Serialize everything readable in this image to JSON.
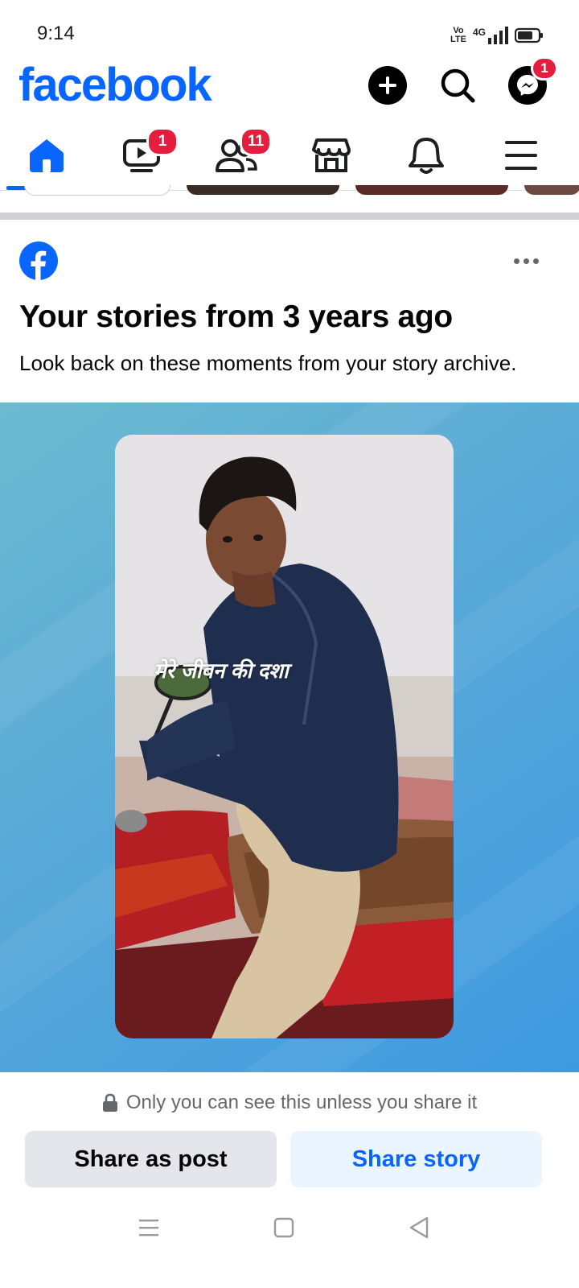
{
  "status_bar": {
    "time": "9:14",
    "volte_top": "Vo",
    "volte_bottom": "LTE",
    "network": "4G",
    "icons": [
      "volte-icon",
      "signal-icon",
      "battery-icon"
    ]
  },
  "header": {
    "logo": "facebook",
    "create_icon": "plus-icon",
    "search_icon": "search-icon",
    "messenger_icon": "messenger-icon",
    "messenger_badge": "1"
  },
  "tabs": [
    {
      "name": "home",
      "icon": "home-icon",
      "active": true,
      "badge": ""
    },
    {
      "name": "video",
      "icon": "video-icon",
      "active": false,
      "badge": "1"
    },
    {
      "name": "friends",
      "icon": "friends-icon",
      "active": false,
      "badge": "11"
    },
    {
      "name": "marketplace",
      "icon": "marketplace-icon",
      "active": false,
      "badge": ""
    },
    {
      "name": "notifications",
      "icon": "bell-icon",
      "active": false,
      "badge": ""
    },
    {
      "name": "menu",
      "icon": "menu-icon",
      "active": false,
      "badge": ""
    }
  ],
  "memory_card": {
    "title": "Your stories from 3 years ago",
    "subtitle": "Look back on these moments from your story archive.",
    "story_caption": "मेरे जीवन की दशा",
    "privacy_note": "Only you can see this unless you share it",
    "share_post_label": "Share as post",
    "share_story_label": "Share story"
  },
  "nav_bar": {
    "icons": [
      "recent-apps-icon",
      "home-square-icon",
      "back-triangle-icon"
    ]
  },
  "colors": {
    "brand_blue": "#0866ff",
    "badge_red": "#e41e3f",
    "background_gradient_start": "#6cbad0",
    "background_gradient_end": "#3e9ae0"
  }
}
